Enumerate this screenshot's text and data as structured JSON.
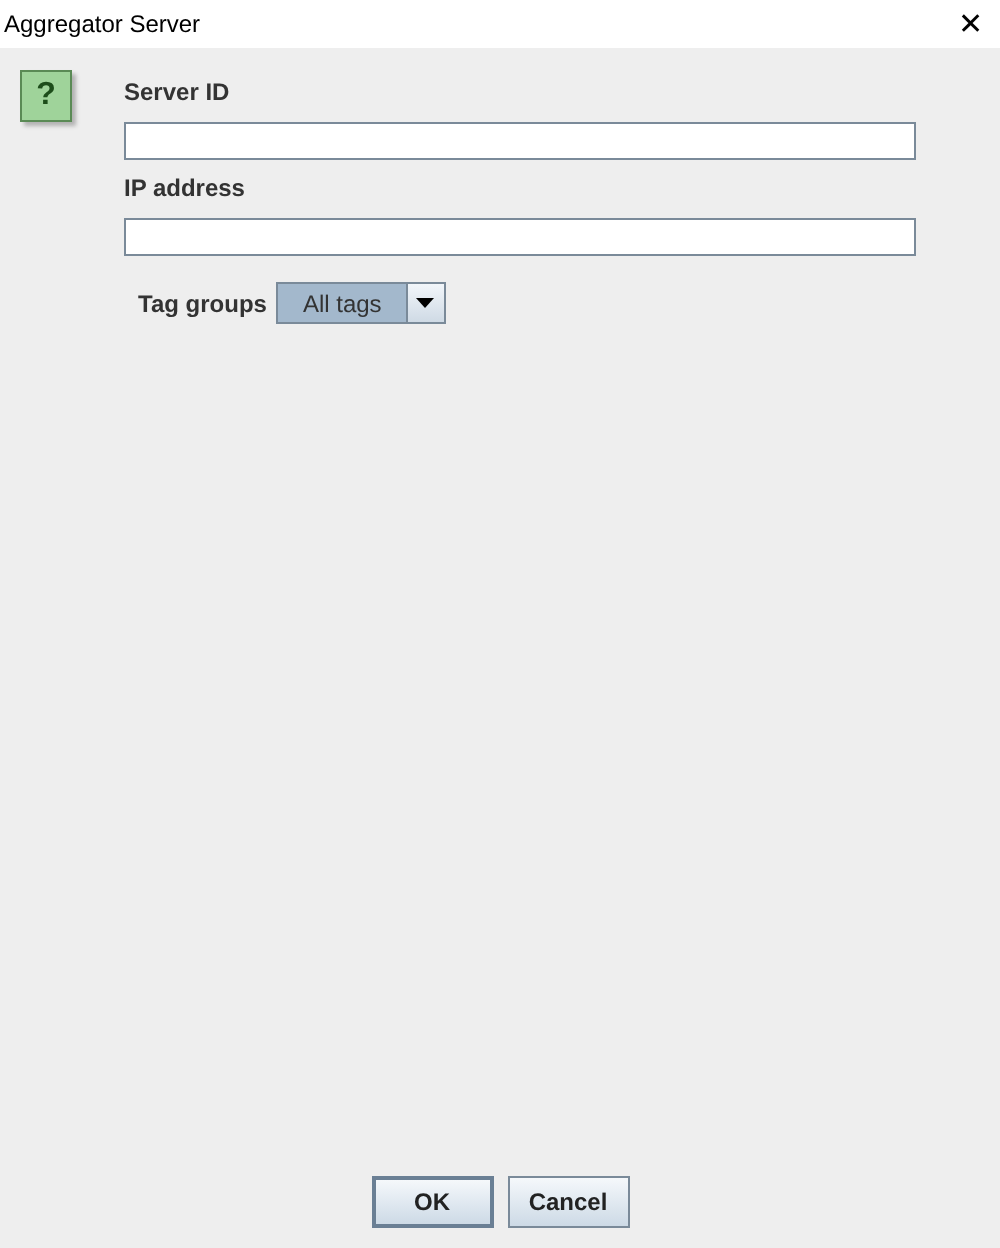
{
  "window": {
    "title": "Aggregator Server",
    "close": "✕"
  },
  "help_icon": "?",
  "fields": [
    {
      "label": "Server ID"
    },
    {
      "label": "IP address"
    }
  ],
  "tag_groups": {
    "label": "Tag groups",
    "value": "All tags"
  },
  "buttons": [
    {
      "label": "OK",
      "focused": true
    },
    {
      "label": "Cancel",
      "focused": false
    }
  ]
}
